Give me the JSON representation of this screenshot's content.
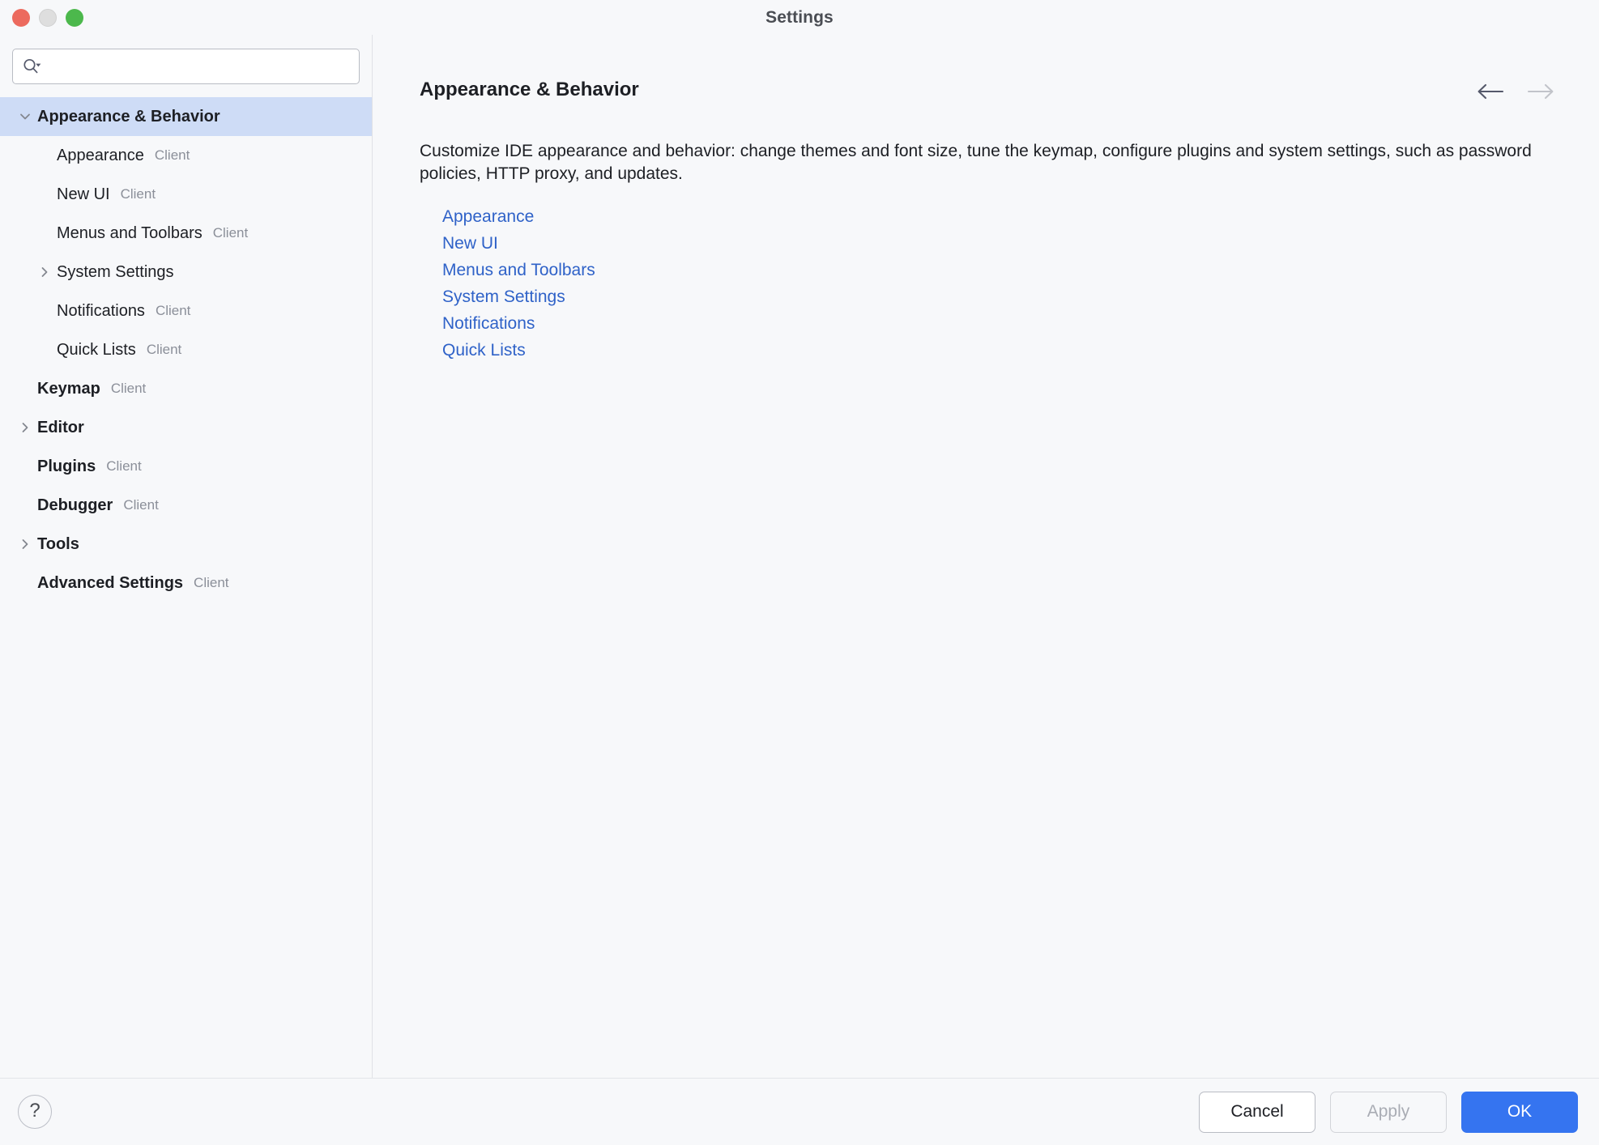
{
  "window": {
    "title": "Settings",
    "traffic_lights": [
      "close",
      "minimize",
      "maximize"
    ]
  },
  "sidebar": {
    "search": {
      "value": "",
      "placeholder": "",
      "icon": "search-icon-with-dropdown"
    },
    "items": [
      {
        "label": "Appearance & Behavior",
        "tag": "",
        "level": 0,
        "twisty": "chevron-down",
        "selected": true,
        "bold": true
      },
      {
        "label": "Appearance",
        "tag": "Client",
        "level": 1,
        "twisty": "none",
        "selected": false,
        "bold": false
      },
      {
        "label": "New UI",
        "tag": "Client",
        "level": 1,
        "twisty": "none",
        "selected": false,
        "bold": false
      },
      {
        "label": "Menus and Toolbars",
        "tag": "Client",
        "level": 1,
        "twisty": "none",
        "selected": false,
        "bold": false
      },
      {
        "label": "System Settings",
        "tag": "",
        "level": 1,
        "twisty": "chevron-right",
        "selected": false,
        "bold": false
      },
      {
        "label": "Notifications",
        "tag": "Client",
        "level": 1,
        "twisty": "none",
        "selected": false,
        "bold": false
      },
      {
        "label": "Quick Lists",
        "tag": "Client",
        "level": 1,
        "twisty": "none",
        "selected": false,
        "bold": false
      },
      {
        "label": "Keymap",
        "tag": "Client",
        "level": 0,
        "twisty": "none",
        "selected": false,
        "bold": true
      },
      {
        "label": "Editor",
        "tag": "",
        "level": 0,
        "twisty": "chevron-right",
        "selected": false,
        "bold": true
      },
      {
        "label": "Plugins",
        "tag": "Client",
        "level": 0,
        "twisty": "none",
        "selected": false,
        "bold": true
      },
      {
        "label": "Debugger",
        "tag": "Client",
        "level": 0,
        "twisty": "none",
        "selected": false,
        "bold": true
      },
      {
        "label": "Tools",
        "tag": "",
        "level": 0,
        "twisty": "chevron-right",
        "selected": false,
        "bold": true
      },
      {
        "label": "Advanced Settings",
        "tag": "Client",
        "level": 0,
        "twisty": "none",
        "selected": false,
        "bold": true
      }
    ]
  },
  "content": {
    "title": "Appearance & Behavior",
    "description": "Customize IDE appearance and behavior: change themes and font size, tune the keymap, configure plugins and system settings, such as password policies, HTTP proxy, and updates.",
    "nav": {
      "back_enabled": true,
      "forward_enabled": false
    },
    "links": [
      "Appearance",
      "New UI",
      "Menus and Toolbars",
      "System Settings",
      "Notifications",
      "Quick Lists"
    ]
  },
  "footer": {
    "help_label": "?",
    "buttons": [
      {
        "label": "Cancel",
        "style": "secondary"
      },
      {
        "label": "Apply",
        "style": "disabled"
      },
      {
        "label": "OK",
        "style": "primary"
      }
    ]
  },
  "colors": {
    "accent": "#3574f0",
    "link": "#2f62c8",
    "selection": "#cedcf6",
    "background": "#f7f8fa",
    "traffic_close": "#ec6a5e",
    "traffic_min": "#dedede",
    "traffic_zoom": "#4cb84c",
    "tag_text": "#8b8f99",
    "arrow_enabled": "#55596b",
    "arrow_disabled": "#c2c4ca"
  }
}
